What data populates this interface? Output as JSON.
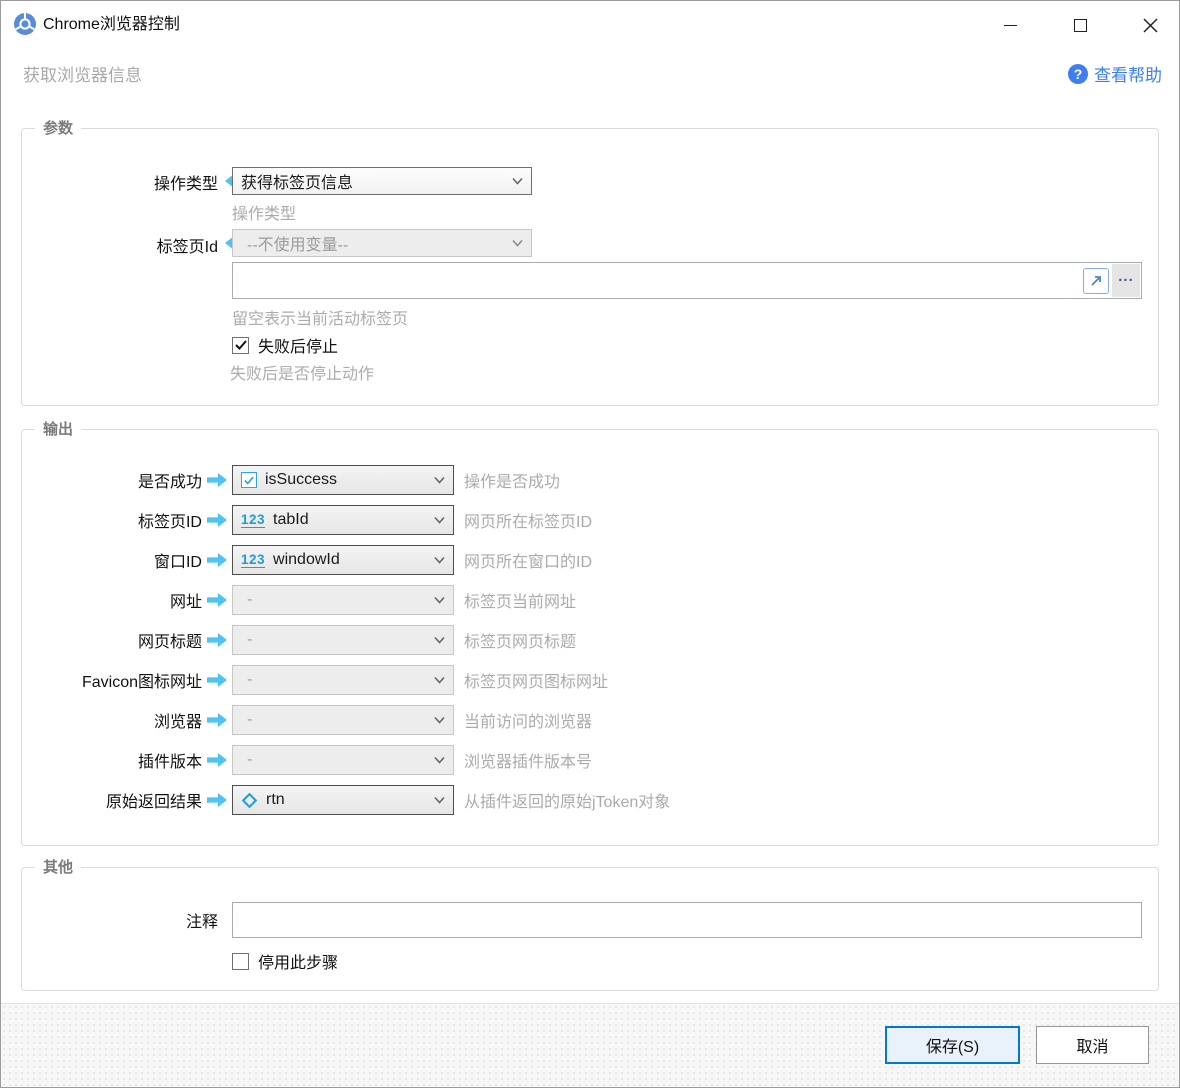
{
  "window": {
    "title": "Chrome浏览器控制",
    "subtitle": "获取浏览器信息",
    "help_label": "查看帮助"
  },
  "colors": {
    "accent_blue": "#3e7ef0",
    "variable_blue": "#1e9cd7",
    "arrow_cyan": "#4fc4f2",
    "save_border": "#0078d7"
  },
  "params_group": {
    "legend": "参数",
    "operation_type": {
      "label": "操作类型",
      "value": "获得标签页信息",
      "helper": "操作类型"
    },
    "tab_id": {
      "label": "标签页Id",
      "value": "--不使用变量--",
      "helper": "留空表示当前活动标签页"
    },
    "tab_id_input": {
      "value": "",
      "more_label": "..."
    },
    "stop_on_fail": {
      "label": "失败后停止",
      "checked": true,
      "helper": "失败后是否停止动作"
    }
  },
  "output_group": {
    "legend": "输出",
    "rows": [
      {
        "label": "是否成功",
        "icon": "checkbox",
        "icon_text": "",
        "value": "isSuccess",
        "helper": "操作是否成功",
        "disabled": false
      },
      {
        "label": "标签页ID",
        "icon": "number",
        "icon_text": "123",
        "value": "tabId",
        "helper": "网页所在标签页ID",
        "disabled": false
      },
      {
        "label": "窗口ID",
        "icon": "number",
        "icon_text": "123",
        "value": "windowId",
        "helper": "网页所在窗口的ID",
        "disabled": false
      },
      {
        "label": "网址",
        "icon": null,
        "icon_text": "",
        "value": "-",
        "helper": "标签页当前网址",
        "disabled": true
      },
      {
        "label": "网页标题",
        "icon": null,
        "icon_text": "",
        "value": "-",
        "helper": "标签页网页标题",
        "disabled": true
      },
      {
        "label": "Favicon图标网址",
        "icon": null,
        "icon_text": "",
        "value": "-",
        "helper": "标签页网页图标网址",
        "disabled": true
      },
      {
        "label": "浏览器",
        "icon": null,
        "icon_text": "",
        "value": "-",
        "helper": "当前访问的浏览器",
        "disabled": true
      },
      {
        "label": "插件版本",
        "icon": null,
        "icon_text": "",
        "value": "-",
        "helper": "浏览器插件版本号",
        "disabled": true
      },
      {
        "label": "原始返回结果",
        "icon": "object",
        "icon_text": "",
        "value": "rtn",
        "helper": "从插件返回的原始jToken对象",
        "disabled": false
      }
    ]
  },
  "other_group": {
    "legend": "其他",
    "comment": {
      "label": "注释",
      "value": ""
    },
    "disable_step": {
      "label": "停用此步骤",
      "checked": false
    }
  },
  "footer": {
    "save_label": "保存(S)",
    "cancel_label": "取消"
  }
}
